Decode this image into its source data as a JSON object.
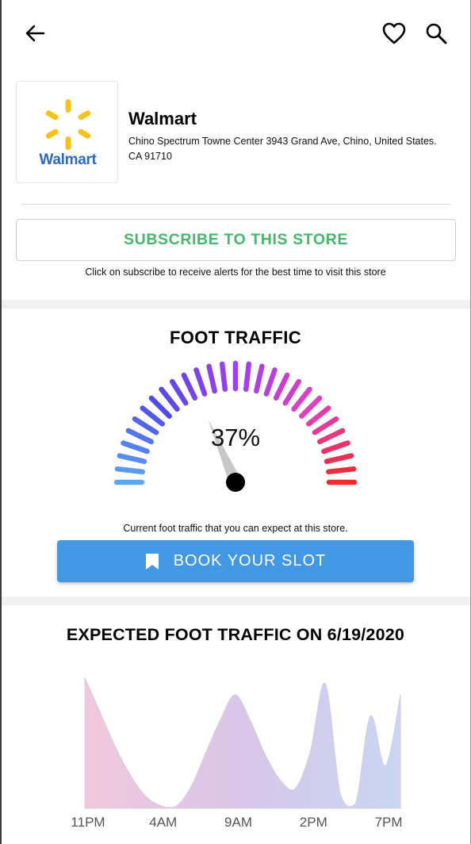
{
  "header": {
    "back_icon": "arrow-left-icon",
    "favorite_icon": "heart-outline-icon",
    "search_icon": "search-icon"
  },
  "store": {
    "logo_text": "Walmart",
    "logo_icon": "walmart-spark-icon",
    "name": "Walmart",
    "address": "Chino Spectrum Towne Center 3943 Grand Ave, Chino, United States. CA 91710"
  },
  "subscribe": {
    "label": "SUBSCRIBE TO THIS STORE",
    "hint": "Click on subscribe to receive alerts for the best time to visit this store",
    "color": "#45b86e"
  },
  "foot_traffic": {
    "title": "FOOT TRAFFIC",
    "value_text": "37%",
    "value": 37,
    "caption": "Current foot traffic that you can expect at this store.",
    "gradient_colors": [
      "#5aa8f5",
      "#4f4be8",
      "#a03ef0",
      "#e040c0",
      "#ee2a2a"
    ]
  },
  "book": {
    "label": "BOOK YOUR SLOT",
    "icon": "bookmark-icon",
    "color": "#4398e3"
  },
  "expected": {
    "title": "EXPECTED FOOT TRAFFIC ON 6/19/2020"
  },
  "chart_data": {
    "type": "area",
    "title": "EXPECTED FOOT TRAFFIC ON 6/19/2020",
    "x_tick_labels": [
      "11PM",
      "4AM",
      "9AM",
      "2PM",
      "7PM"
    ],
    "x": [
      "11PM",
      "12AM",
      "1AM",
      "2AM",
      "3AM",
      "4AM",
      "5AM",
      "6AM",
      "7AM",
      "8AM",
      "9AM",
      "10AM",
      "11AM",
      "12PM",
      "1PM",
      "2PM",
      "3PM",
      "4PM",
      "5PM",
      "6PM",
      "7PM",
      "8PM"
    ],
    "values": [
      92,
      68,
      44,
      24,
      9,
      2,
      1,
      14,
      38,
      62,
      80,
      62,
      38,
      20,
      14,
      40,
      88,
      10,
      3,
      65,
      30,
      80
    ],
    "ylim": [
      0,
      100
    ],
    "grid": false,
    "fill_colors": [
      "#f2c8dc",
      "#d8c6e8",
      "#c7d6f3"
    ]
  }
}
